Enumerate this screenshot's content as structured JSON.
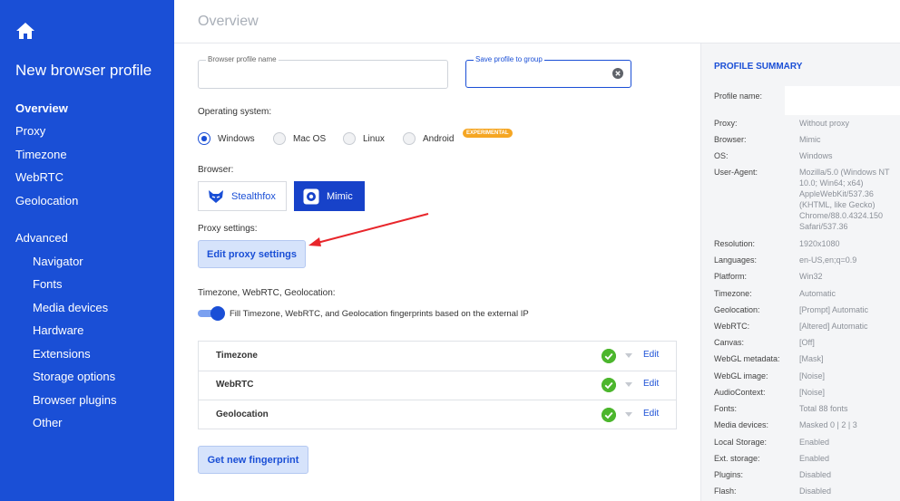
{
  "sidebar": {
    "title": "New browser profile",
    "items": [
      {
        "label": "Overview"
      },
      {
        "label": "Proxy"
      },
      {
        "label": "Timezone"
      },
      {
        "label": "WebRTC"
      },
      {
        "label": "Geolocation"
      },
      {
        "label": "Advanced"
      },
      {
        "label": "Navigator"
      },
      {
        "label": "Fonts"
      },
      {
        "label": "Media devices"
      },
      {
        "label": "Hardware"
      },
      {
        "label": "Extensions"
      },
      {
        "label": "Storage options"
      },
      {
        "label": "Browser plugins"
      },
      {
        "label": "Other"
      }
    ]
  },
  "header": {
    "title": "Overview"
  },
  "main": {
    "profile_name": {
      "label": "Browser profile name",
      "value": ""
    },
    "save_group": {
      "label": "Save profile to group",
      "value": ""
    },
    "os": {
      "label": "Operating system:",
      "options": [
        "Windows",
        "Mac OS",
        "Linux",
        "Android"
      ],
      "selected": "Windows",
      "badge": "EXPERIMENTAL"
    },
    "browser": {
      "label": "Browser:",
      "options": [
        "Stealthfox",
        "Mimic"
      ],
      "selected": "Mimic"
    },
    "proxy": {
      "label": "Proxy settings:",
      "button": "Edit proxy settings"
    },
    "geo": {
      "label": "Timezone, WebRTC, Geolocation:",
      "toggle_text": "Fill Timezone, WebRTC, and Geolocation fingerprints based on the external IP",
      "rows": [
        {
          "name": "Timezone",
          "edit": "Edit"
        },
        {
          "name": "WebRTC",
          "edit": "Edit"
        },
        {
          "name": "Geolocation",
          "edit": "Edit"
        }
      ]
    },
    "fingerprint_button": "Get new fingerprint"
  },
  "summary": {
    "title": "PROFILE SUMMARY",
    "profile_name_label": "Profile name:",
    "rows": [
      {
        "key": "Proxy:",
        "value": "Without proxy"
      },
      {
        "key": "Browser:",
        "value": "Mimic"
      },
      {
        "key": "OS:",
        "value": "Windows"
      },
      {
        "key": "User-Agent:",
        "value": "Mozilla/5.0 (Windows NT 10.0; Win64; x64) AppleWebKit/537.36 (KHTML, like Gecko) Chrome/88.0.4324.150 Safari/537.36"
      },
      {
        "key": "Resolution:",
        "value": "1920x1080"
      },
      {
        "key": "Languages:",
        "value": "en-US,en;q=0.9"
      },
      {
        "key": "Platform:",
        "value": "Win32"
      },
      {
        "key": "Timezone:",
        "value": "Automatic"
      },
      {
        "key": "Geolocation:",
        "value": "[Prompt] Automatic"
      },
      {
        "key": "WebRTC:",
        "value": "[Altered] Automatic"
      },
      {
        "key": "Canvas:",
        "value": "[Off]"
      },
      {
        "key": "WebGL metadata:",
        "value": "[Mask]"
      },
      {
        "key": "WebGL image:",
        "value": "[Noise]"
      },
      {
        "key": "AudioContext:",
        "value": "[Noise]"
      },
      {
        "key": "Fonts:",
        "value": "Total 88 fonts"
      },
      {
        "key": "Media devices:",
        "value": "Masked 0 | 2 | 3"
      },
      {
        "key": "Local Storage:",
        "value": "Enabled"
      },
      {
        "key": "Ext. storage:",
        "value": "Enabled"
      },
      {
        "key": "Plugins:",
        "value": "Disabled"
      },
      {
        "key": "Flash:",
        "value": "Disabled"
      }
    ]
  },
  "colors": {
    "brand": "#1a4fd6",
    "success": "#4cb62d",
    "badge": "#f5a623",
    "annotation_arrow": "#e8262b"
  },
  "icons": [
    "home-icon",
    "clear-icon",
    "fox-icon",
    "mimic-icon",
    "check-icon",
    "chevron-down-icon",
    "arrow-annotation"
  ]
}
